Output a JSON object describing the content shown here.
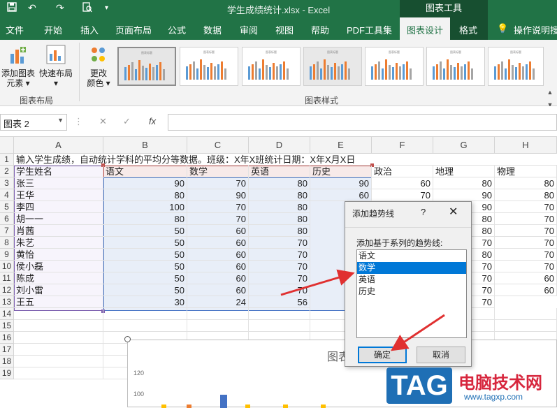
{
  "titlebar": {
    "title": "学生成绩统计.xlsx  -  Excel",
    "context_group": "图表工具",
    "icons": [
      "save-icon",
      "undo-icon",
      "redo-icon",
      "print-preview-icon",
      "customize-qat-icon"
    ]
  },
  "tabs": [
    {
      "label": "文件",
      "name": "tab-file"
    },
    {
      "label": "开始",
      "name": "tab-home"
    },
    {
      "label": "插入",
      "name": "tab-insert"
    },
    {
      "label": "页面布局",
      "name": "tab-page-layout"
    },
    {
      "label": "公式",
      "name": "tab-formulas"
    },
    {
      "label": "数据",
      "name": "tab-data"
    },
    {
      "label": "审阅",
      "name": "tab-review"
    },
    {
      "label": "视图",
      "name": "tab-view"
    },
    {
      "label": "帮助",
      "name": "tab-help"
    },
    {
      "label": "PDF工具集",
      "name": "tab-pdf-tools"
    },
    {
      "label": "图表设计",
      "name": "tab-chart-design",
      "active": true
    },
    {
      "label": "格式",
      "name": "tab-format"
    }
  ],
  "tell_me": "操作说明搜",
  "ribbon": {
    "add_element": [
      "添加图表",
      "元素"
    ],
    "quick_layout": "快速布局",
    "change_colors": [
      "更改",
      "颜色"
    ],
    "group_layout": "图表布局",
    "group_styles": "图表样式",
    "style_thumb_title": "图表标题"
  },
  "formula": {
    "name_box": "图表 2",
    "fx": "fx",
    "cancel": "✕",
    "enter": "✓"
  },
  "columns": [
    "A",
    "B",
    "C",
    "D",
    "E",
    "F",
    "G",
    "H"
  ],
  "rows": [
    "1",
    "2",
    "3",
    "4",
    "5",
    "6",
    "7",
    "8",
    "9",
    "10",
    "11",
    "12",
    "13",
    "14",
    "15",
    "16",
    "17",
    "18",
    "19"
  ],
  "sheet": {
    "row1": "输入学生成绩，自动统计学科的平均分等数据。班级：X年X班统计日期：X年X月X日",
    "headers": [
      "学生姓名",
      "语文",
      "数学",
      "英语",
      "历史",
      "政治",
      "地理",
      "物理"
    ],
    "students": [
      {
        "name": "张三",
        "scores": [
          "90",
          "70",
          "80",
          "90",
          "60",
          "80",
          "80"
        ]
      },
      {
        "name": "王华",
        "scores": [
          "80",
          "90",
          "80",
          "60",
          "70",
          "90",
          "80"
        ]
      },
      {
        "name": "李四",
        "scores": [
          "100",
          "70",
          "80",
          "",
          "",
          "",
          "70"
        ]
      },
      {
        "name": "胡一一",
        "scores": [
          "80",
          "70",
          "80",
          "",
          "",
          "",
          "70"
        ]
      },
      {
        "name": "肖茜",
        "scores": [
          "50",
          "60",
          "80",
          "",
          "",
          "",
          "70"
        ]
      },
      {
        "name": "朱艺",
        "scores": [
          "50",
          "60",
          "70",
          "",
          "",
          "",
          "70"
        ]
      },
      {
        "name": "黄怡",
        "scores": [
          "50",
          "60",
          "70",
          "",
          "",
          "",
          "70"
        ]
      },
      {
        "name": "侯小磊",
        "scores": [
          "50",
          "60",
          "70",
          "",
          "",
          "",
          "70"
        ]
      },
      {
        "name": "陈成",
        "scores": [
          "50",
          "60",
          "70",
          "",
          "",
          "",
          "60"
        ]
      },
      {
        "name": "刘小雷",
        "scores": [
          "50",
          "60",
          "70",
          "",
          "",
          "",
          "60"
        ]
      },
      {
        "name": "王五",
        "scores": [
          "30",
          "24",
          "56",
          "",
          "",
          "",
          ""
        ]
      }
    ],
    "visible_right": {
      "F": {
        "row5": "70"
      },
      "G": {
        "row5": "90",
        "row6": "80",
        "row7": "80",
        "row8": "70",
        "row9": "80",
        "row10": "70",
        "row11": "70",
        "row12": "70",
        "row13": "70"
      }
    }
  },
  "chart": {
    "title_partial": "图表",
    "y_ticks": [
      "120",
      "100"
    ]
  },
  "dialog": {
    "title": "添加趋势线",
    "help": "?",
    "close": "✕",
    "label": "添加基于系列的趋势线:",
    "options": [
      "语文",
      "数学",
      "英语",
      "历史"
    ],
    "selected": "数学",
    "ok": "确定",
    "cancel": "取消"
  },
  "watermark": {
    "tag": "TAG",
    "site_cn": "电脑技术网",
    "url": "www.tagxp.com"
  },
  "colors": {
    "excel_green": "#217346",
    "selection_blue": "#0078d7",
    "arrow_red": "#e03030"
  }
}
